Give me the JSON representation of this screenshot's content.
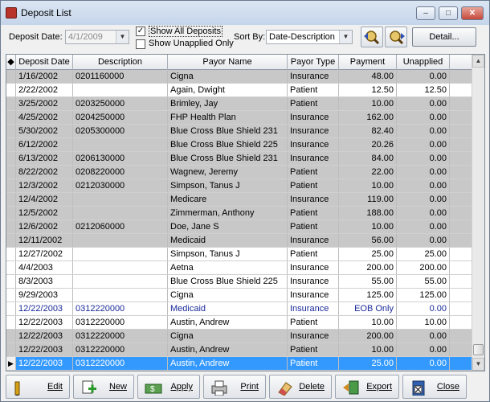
{
  "window": {
    "title": "Deposit List"
  },
  "titlebar_buttons": {
    "minimize": "–",
    "maximize": "□",
    "close": "✕"
  },
  "filters": {
    "deposit_date_label": "Deposit Date:",
    "deposit_date_value": "4/1/2009",
    "show_all_deposits_label": "Show All Deposits",
    "show_all_deposits_checked": true,
    "show_unapplied_only_label": "Show Unapplied Only",
    "show_unapplied_only_checked": false,
    "sort_by_label": "Sort By:",
    "sort_by_value": "Date-Description"
  },
  "detail_button": "Detail...",
  "grid": {
    "columns": [
      "Deposit Date",
      "Description",
      "Payor Name",
      "Payor Type",
      "Payment",
      "Unapplied"
    ],
    "rows": [
      {
        "date": "1/16/2002",
        "desc": "0201160000",
        "payor": "Cigna",
        "type": "Insurance",
        "payment": "48.00",
        "unapplied": "0.00",
        "style": "gray"
      },
      {
        "date": "2/22/2002",
        "desc": "",
        "payor": "Again, Dwight",
        "type": "Patient",
        "payment": "12.50",
        "unapplied": "12.50",
        "style": "white"
      },
      {
        "date": "3/25/2002",
        "desc": "0203250000",
        "payor": "Brimley, Jay",
        "type": "Patient",
        "payment": "10.00",
        "unapplied": "0.00",
        "style": "gray"
      },
      {
        "date": "4/25/2002",
        "desc": "0204250000",
        "payor": "FHP Health Plan",
        "type": "Insurance",
        "payment": "162.00",
        "unapplied": "0.00",
        "style": "gray"
      },
      {
        "date": "5/30/2002",
        "desc": "0205300000",
        "payor": "Blue Cross Blue Shield 231",
        "type": "Insurance",
        "payment": "82.40",
        "unapplied": "0.00",
        "style": "gray"
      },
      {
        "date": "6/12/2002",
        "desc": "",
        "payor": "Blue Cross Blue Shield 225",
        "type": "Insurance",
        "payment": "20.26",
        "unapplied": "0.00",
        "style": "gray"
      },
      {
        "date": "6/13/2002",
        "desc": "0206130000",
        "payor": "Blue Cross Blue Shield 231",
        "type": "Insurance",
        "payment": "84.00",
        "unapplied": "0.00",
        "style": "gray"
      },
      {
        "date": "8/22/2002",
        "desc": "0208220000",
        "payor": "Wagnew, Jeremy",
        "type": "Patient",
        "payment": "22.00",
        "unapplied": "0.00",
        "style": "gray"
      },
      {
        "date": "12/3/2002",
        "desc": "0212030000",
        "payor": "Simpson, Tanus J",
        "type": "Patient",
        "payment": "10.00",
        "unapplied": "0.00",
        "style": "gray"
      },
      {
        "date": "12/4/2002",
        "desc": "",
        "payor": "Medicare",
        "type": "Insurance",
        "payment": "119.00",
        "unapplied": "0.00",
        "style": "gray"
      },
      {
        "date": "12/5/2002",
        "desc": "",
        "payor": "Zimmerman, Anthony",
        "type": "Patient",
        "payment": "188.00",
        "unapplied": "0.00",
        "style": "gray"
      },
      {
        "date": "12/6/2002",
        "desc": "0212060000",
        "payor": "Doe, Jane S",
        "type": "Patient",
        "payment": "10.00",
        "unapplied": "0.00",
        "style": "gray"
      },
      {
        "date": "12/11/2002",
        "desc": "",
        "payor": "Medicaid",
        "type": "Insurance",
        "payment": "56.00",
        "unapplied": "0.00",
        "style": "gray"
      },
      {
        "date": "12/27/2002",
        "desc": "",
        "payor": "Simpson, Tanus J",
        "type": "Patient",
        "payment": "25.00",
        "unapplied": "25.00",
        "style": "white"
      },
      {
        "date": "4/4/2003",
        "desc": "",
        "payor": "Aetna",
        "type": "Insurance",
        "payment": "200.00",
        "unapplied": "200.00",
        "style": "white"
      },
      {
        "date": "8/3/2003",
        "desc": "",
        "payor": "Blue Cross Blue Shield 225",
        "type": "Insurance",
        "payment": "55.00",
        "unapplied": "55.00",
        "style": "white"
      },
      {
        "date": "9/29/2003",
        "desc": "",
        "payor": "Cigna",
        "type": "Insurance",
        "payment": "125.00",
        "unapplied": "125.00",
        "style": "white"
      },
      {
        "date": "12/22/2003",
        "desc": "0312220000",
        "payor": "Medicaid",
        "type": "Insurance",
        "payment": "EOB Only",
        "unapplied": "0.00",
        "style": "white blue"
      },
      {
        "date": "12/22/2003",
        "desc": "0312220000",
        "payor": "Austin, Andrew",
        "type": "Patient",
        "payment": "10.00",
        "unapplied": "10.00",
        "style": "white"
      },
      {
        "date": "12/22/2003",
        "desc": "0312220000",
        "payor": "Cigna",
        "type": "Insurance",
        "payment": "200.00",
        "unapplied": "0.00",
        "style": "gray"
      },
      {
        "date": "12/22/2003",
        "desc": "0312220000",
        "payor": "Austin, Andrew",
        "type": "Patient",
        "payment": "10.00",
        "unapplied": "0.00",
        "style": "gray"
      },
      {
        "date": "12/22/2003",
        "desc": "0312220000",
        "payor": "Austin, Andrew",
        "type": "Patient",
        "payment": "25.00",
        "unapplied": "0.00",
        "style": "selected"
      }
    ]
  },
  "buttons": {
    "edit": "Edit",
    "new": "New",
    "apply": "Apply",
    "print": "Print",
    "delete": "Delete",
    "export": "Export",
    "close": "Close"
  },
  "colors": {
    "selected_row": "#3399ff",
    "gray_row": "#c8c8c8",
    "eob_text": "#1a2a9a"
  }
}
